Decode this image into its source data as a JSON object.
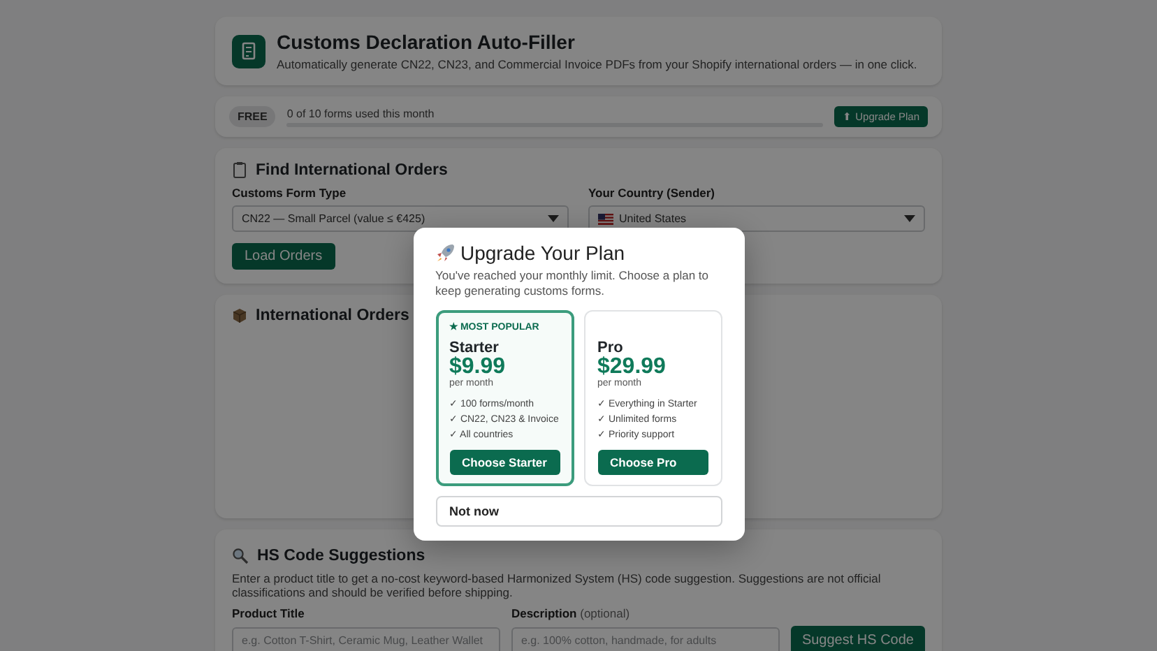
{
  "header": {
    "title": "Customs Declaration Auto-Filler",
    "subtitle": "Automatically generate CN22, CN23, and Commercial Invoice PDFs from your Shopify international orders — in one click."
  },
  "usage": {
    "badge": "FREE",
    "text": "0 of 10 forms used this month",
    "level": 0,
    "button": "⬆ Upgrade Plan"
  },
  "find_orders": {
    "title": "Find International Orders",
    "fields": [
      {
        "kind": "select",
        "label": "Customs Form Type",
        "value": "CN22 — Small Parcel (value ≤ €425)",
        "flag": false
      },
      {
        "kind": "select",
        "label": "Your Country (Sender)",
        "value": "United States",
        "flag": true
      }
    ],
    "button": "Load Orders"
  },
  "international_orders": {
    "title": "International Orders"
  },
  "hs_code": {
    "title": "HS Code Suggestions",
    "description": "Enter a product title to get a no-cost keyword-based Harmonized System (HS) code suggestion. Suggestions are not official classifications and should be verified before shipping.",
    "fields": [
      {
        "label": "Product Title",
        "placeholder": "e.g. Cotton T-Shirt, Ceramic Mug, Leather Wallet"
      },
      {
        "label": "Description",
        "note": "(optional)",
        "placeholder": "e.g. 100% cotton, handmade, for adults"
      }
    ],
    "button": "Suggest HS Code"
  },
  "modal": {
    "title": "Upgrade Your Plan",
    "text": "You've reached your monthly limit. Choose a plan to keep generating customs forms.",
    "plans": [
      {
        "badge": "★ MOST POPULAR",
        "name": "Starter",
        "price": "$9.99",
        "period": "per month",
        "features": [
          "✓ 100 forms/month",
          "✓ CN22, CN23 & Invoice",
          "✓ All countries"
        ],
        "button": "Choose Starter",
        "selected": true
      },
      {
        "name": "Pro",
        "price": "$29.99",
        "period": "per month",
        "features": [
          "✓ Everything in Starter",
          "✓ Unlimited forms",
          "✓ Priority support"
        ],
        "button": "Choose Pro",
        "selected": false
      }
    ],
    "dismiss": "Not now"
  }
}
